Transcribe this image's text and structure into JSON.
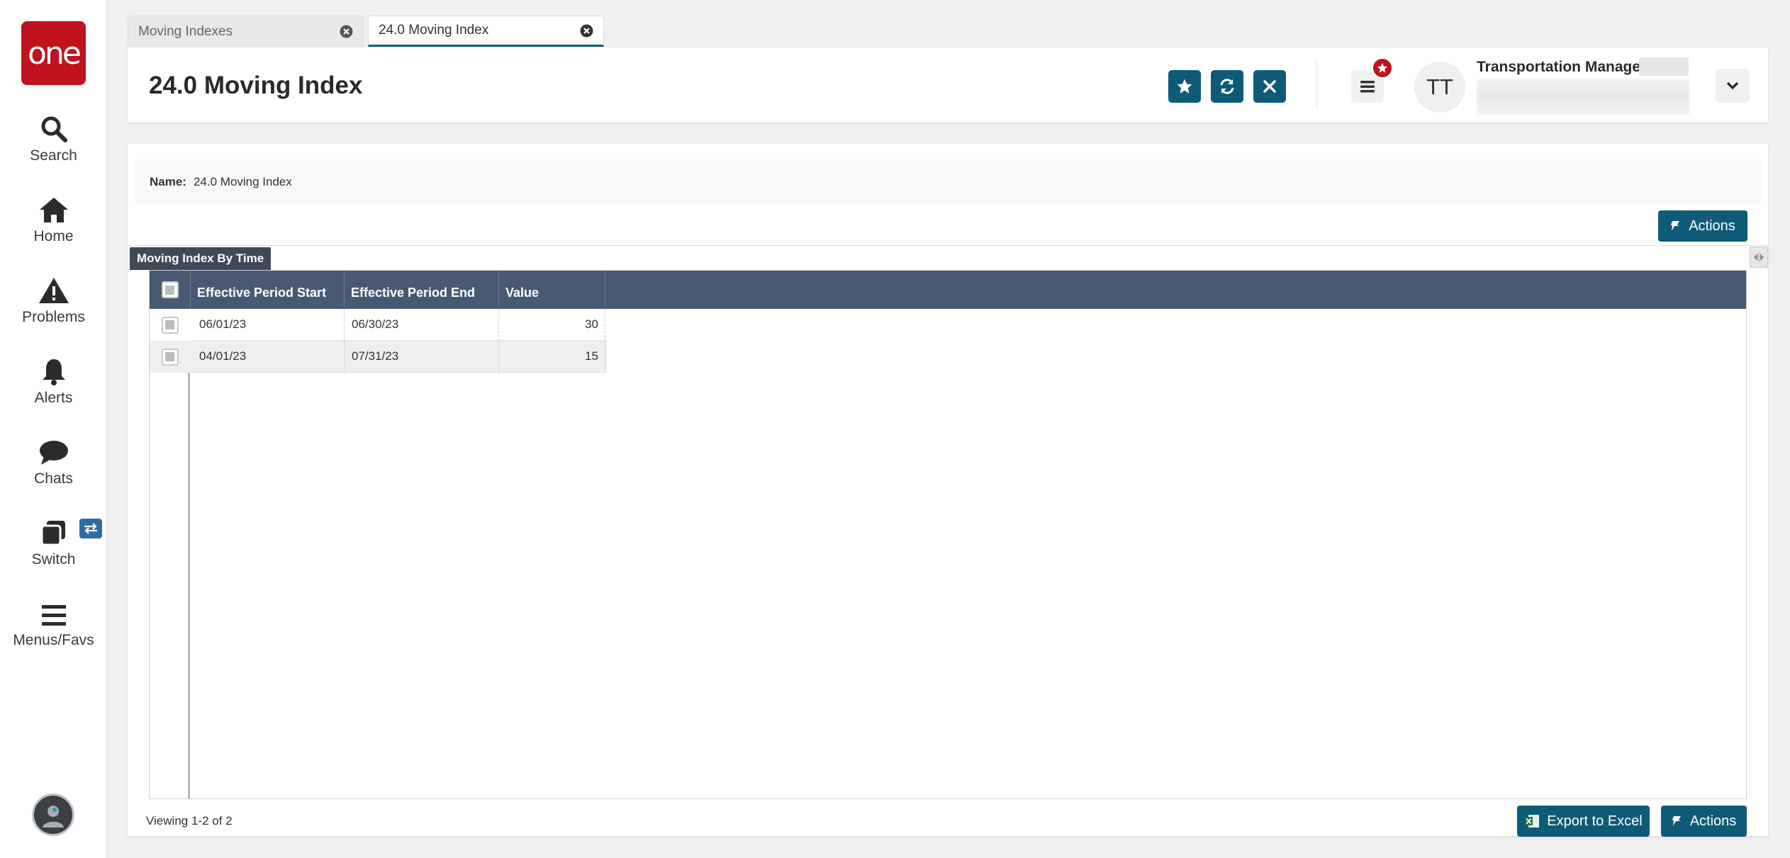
{
  "leftnav": {
    "logo_text": "one",
    "items": [
      {
        "label": "Search",
        "icon": "search-icon"
      },
      {
        "label": "Home",
        "icon": "home-icon"
      },
      {
        "label": "Problems",
        "icon": "warning-icon"
      },
      {
        "label": "Alerts",
        "icon": "bell-icon"
      },
      {
        "label": "Chats",
        "icon": "chat-icon"
      },
      {
        "label": "Switch",
        "icon": "switch-icon"
      },
      {
        "label": "Menus/Favs",
        "icon": "hamburger-icon"
      }
    ]
  },
  "tabs": [
    {
      "label": "Moving Indexes",
      "active": false
    },
    {
      "label": "24.0 Moving Index",
      "active": true
    }
  ],
  "header": {
    "title": "24.0 Moving Index",
    "user_initials": "TT",
    "user_role": "Transportation Manager"
  },
  "details": {
    "name_label": "Name:",
    "name_value": "24.0 Moving Index"
  },
  "actions_label": "Actions",
  "section": {
    "title": "Moving Index By Time"
  },
  "grid": {
    "columns": [
      "Effective Period Start",
      "Effective Period End",
      "Value"
    ],
    "rows": [
      {
        "start": "06/01/23",
        "end": "06/30/23",
        "value": "30"
      },
      {
        "start": "04/01/23",
        "end": "07/31/23",
        "value": "15"
      }
    ]
  },
  "footer": {
    "viewing": "Viewing 1-2 of 2",
    "export_label": "Export to Excel",
    "actions_label": "Actions"
  },
  "colors": {
    "brand_red": "#c0121f",
    "primary_teal": "#0e5b78",
    "grid_header": "#485a72"
  }
}
